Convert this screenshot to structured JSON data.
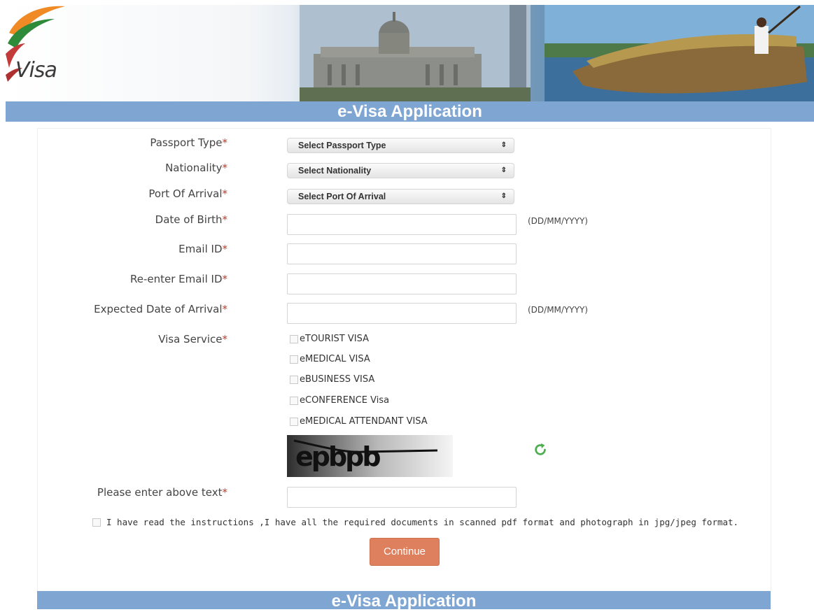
{
  "banner": {
    "logo_text": "Visa",
    "icons": [
      "india-flag-swoosh",
      "parliament-building-photo",
      "houseboat-photo"
    ]
  },
  "header": {
    "title": "e-Visa Application"
  },
  "form": {
    "passport_type": {
      "label": "Passport Type",
      "value": "Select Passport Type"
    },
    "nationality": {
      "label": "Nationality",
      "value": "Select Nationality"
    },
    "port_of_arrival": {
      "label": "Port Of Arrival",
      "value": "Select Port Of Arrival"
    },
    "date_of_birth": {
      "label": "Date of Birth",
      "value": "",
      "hint": "(DD/MM/YYYY)"
    },
    "email": {
      "label": "Email ID",
      "value": ""
    },
    "reenter_email": {
      "label": "Re-enter Email ID",
      "value": ""
    },
    "expected_arrival": {
      "label": "Expected Date of Arrival",
      "value": "",
      "hint": "(DD/MM/YYYY)"
    },
    "visa_service": {
      "label": "Visa Service",
      "options": [
        "eTOURIST VISA",
        "eMEDICAL VISA",
        "eBUSINESS VISA",
        "eCONFERENCE Visa",
        "eMEDICAL ATTENDANT VISA"
      ]
    },
    "captcha": {
      "text": "epbpb",
      "refresh_icon": "refresh-icon"
    },
    "captcha_input": {
      "label": "Please enter above text",
      "value": ""
    },
    "agreement": "I have read the instructions ,I have all the required documents in scanned pdf format and photograph in jpg/jpeg format.",
    "required_marker": "*",
    "select_arrow": "⇕",
    "continue_label": "Continue"
  },
  "footer": {
    "title": "e-Visa Application"
  },
  "colors": {
    "title_bar": "#7fa6d2",
    "continue_button": "#de7f5d",
    "required": "#c0392b",
    "refresh": "#4caf50"
  }
}
